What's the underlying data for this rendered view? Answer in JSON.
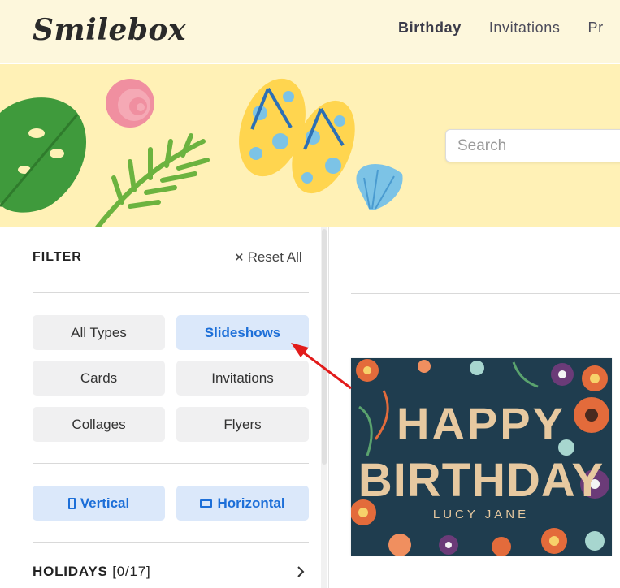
{
  "header": {
    "logo": "Smilebox",
    "nav": [
      {
        "label": "Birthday"
      },
      {
        "label": "Invitations"
      },
      {
        "label": "Pr"
      }
    ]
  },
  "search": {
    "placeholder": "Search"
  },
  "filter": {
    "title": "FILTER",
    "reset_label": "Reset All",
    "types": [
      "All Types",
      "Slideshows",
      "Cards",
      "Invitations",
      "Collages",
      "Flyers"
    ],
    "selected_type": "Slideshows",
    "orientation": [
      "Vertical",
      "Horizontal"
    ],
    "holidays_label": "HOLIDAYS",
    "holidays_count": "[0/17]"
  },
  "card": {
    "line1": "HAPPY",
    "line2": "BIRTHDAY",
    "name": "LUCY JANE"
  },
  "colors": {
    "accent": "#1d6fd8",
    "banner_bg": "#fff1b6",
    "header_bg": "#fdf7dc",
    "card_bg": "#1f3d4f",
    "card_text": "#e7c9a0",
    "annotation_arrow": "#e21b1b"
  }
}
